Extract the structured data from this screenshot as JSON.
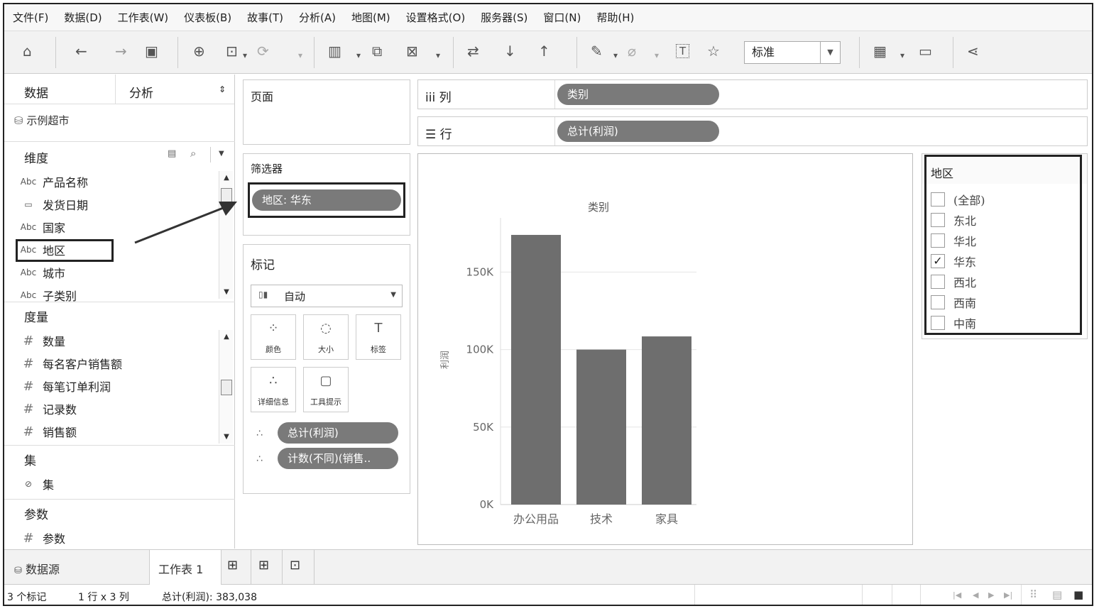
{
  "menu": [
    "文件(F)",
    "数据(D)",
    "工作表(W)",
    "仪表板(B)",
    "故事(T)",
    "分析(A)",
    "地图(M)",
    "设置格式(O)",
    "服务器(S)",
    "窗口(N)",
    "帮助(H)"
  ],
  "toolbar": {
    "home_icon": "⌂",
    "back_icon": "←",
    "forward_icon": "→",
    "save_icon": "▣",
    "new_datasource_icon": "⊕",
    "pause_icon": "⊡",
    "refresh_icon": "⟳",
    "new_sheet_icon": "▥",
    "duplicate_icon": "⧉",
    "clear_icon": "⊠",
    "swap_icon": "⇄",
    "sort_asc_icon": "↓",
    "sort_desc_icon": "↑",
    "highlight_icon": "✎",
    "group_icon": "⌀",
    "label_icon": "T",
    "pin_icon": "☆",
    "fit_value": "标准",
    "show_me_icon": "▦",
    "presentation_icon": "▭",
    "share_icon": "⋖"
  },
  "left_pane": {
    "tab_data": "数据",
    "tab_analysis": "分析",
    "tab_arrows": "⇕",
    "datasource": "示例超市",
    "dimensions_head": "维度",
    "dimensions": [
      {
        "type": "Abc",
        "name": "产品名称"
      },
      {
        "type": "▭",
        "name": "发货日期"
      },
      {
        "type": "Abc",
        "name": "国家"
      },
      {
        "type": "Abc",
        "name": "地区"
      },
      {
        "type": "Abc",
        "name": "城市"
      },
      {
        "type": "Abc",
        "name": "子类别"
      }
    ],
    "measures_head": "度量",
    "measures": [
      {
        "type": "#",
        "name": "数量"
      },
      {
        "type": "#",
        "name": "每名客户销售额"
      },
      {
        "type": "#",
        "name": "每笔订单利润"
      },
      {
        "type": "#",
        "name": "记录数"
      },
      {
        "type": "#",
        "name": "销售额"
      }
    ],
    "sets_head": "集",
    "sets_item": "集",
    "params_head": "参数",
    "params_item": "参数"
  },
  "pages": {
    "title": "页面"
  },
  "filters": {
    "title": "筛选器",
    "pill": "地区: 华东"
  },
  "marks": {
    "title": "标记",
    "type": "自动",
    "buttons": [
      {
        "icon": "⁘",
        "label": "颜色"
      },
      {
        "icon": "◌",
        "label": "大小"
      },
      {
        "icon": "T",
        "label": "标签"
      },
      {
        "icon": "∴",
        "label": "详细信息"
      },
      {
        "icon": "▢",
        "label": "工具提示"
      }
    ],
    "pills": [
      "总计(利润)",
      "计数(不同)(销售.."
    ]
  },
  "shelves": {
    "columns_label": "iii 列",
    "columns_pill": "类别",
    "rows_label": "☰ 行",
    "rows_pill": "总计(利润)"
  },
  "chart_data": {
    "type": "bar",
    "title": "类别",
    "ylabel": "利润",
    "categories": [
      "办公用品",
      "技术",
      "家具"
    ],
    "values": [
      174000,
      100000,
      108500
    ],
    "ylim": [
      0,
      185000
    ],
    "yticks": [
      {
        "v": 0,
        "label": "0K"
      },
      {
        "v": 50000,
        "label": "50K"
      },
      {
        "v": 100000,
        "label": "100K"
      },
      {
        "v": 150000,
        "label": "150K"
      }
    ],
    "bar_color": "#6e6e6e",
    "grid": true
  },
  "legend": {
    "title": "地区",
    "items": [
      {
        "label": "(全部)",
        "checked": false
      },
      {
        "label": "东北",
        "checked": false
      },
      {
        "label": "华北",
        "checked": false
      },
      {
        "label": "华东",
        "checked": true
      },
      {
        "label": "西北",
        "checked": false
      },
      {
        "label": "西南",
        "checked": false
      },
      {
        "label": "中南",
        "checked": false
      }
    ]
  },
  "bottom": {
    "datasource_tab": "数据源",
    "sheet_tab": "工作表 1",
    "status_marks": "3 个标记",
    "status_dims": "1 行 x 3 列",
    "status_sum": "总计(利润): 383,038"
  }
}
